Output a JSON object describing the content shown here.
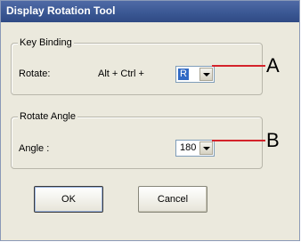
{
  "window": {
    "title": "Display Rotation Tool"
  },
  "key_binding": {
    "legend": "Key Binding",
    "rotate_label": "Rotate:",
    "modifiers": "Alt + Ctrl +",
    "key_value": "R"
  },
  "rotate_angle": {
    "legend": "Rotate Angle",
    "angle_label": "Angle :",
    "angle_value": "180"
  },
  "buttons": {
    "ok": "OK",
    "cancel": "Cancel"
  },
  "callouts": {
    "a": "A",
    "b": "B"
  },
  "colors": {
    "callout_line": "#d4232b",
    "title_bar": "#3b5894",
    "selection": "#316ac5"
  }
}
